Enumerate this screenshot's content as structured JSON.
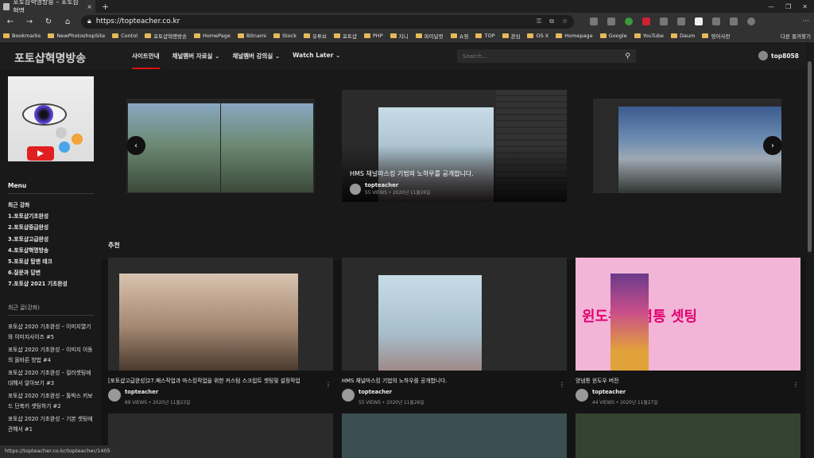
{
  "browser": {
    "tab_title": "포토샵혁명방송 – 포토샵혁명",
    "tab_close": "×",
    "new_tab": "+",
    "url": "https://topteacher.co.kr",
    "window_controls": [
      "—",
      "❐",
      "✕"
    ],
    "menu_more": "···"
  },
  "bookmarks": [
    "Bookmarks",
    "NewPhotoshopSite",
    "Contol",
    "포토샵혁명방송",
    "HomePage",
    "Bitnami",
    "Stock",
    "유투브",
    "포토샵",
    "PHP",
    "지니",
    "파이널컷",
    "쇼핑",
    "TOP",
    "관심",
    "OS X",
    "Homepage",
    "Google",
    "YouTube",
    "Daum",
    "영어사전"
  ],
  "bookmarks_more": "다른 즐겨찾기",
  "site": {
    "logo": "포토샵혁명방송",
    "menu": [
      "사이트안내",
      "채널멤버 자료실",
      "채널멤버 강의실",
      "Watch Later"
    ],
    "search_placeholder": "Search...",
    "user": "top8058"
  },
  "sidebar": {
    "menu_title": "Menu",
    "menu_items": [
      "최근 강좌",
      "1.포토샵기초완성",
      "2.포토샵중급완성",
      "3.포토샵고급완성",
      "4.포토샵혁명방송",
      "5.포토샵 탑맨 테크",
      "6.질문과 답변",
      "7.포토샵 2021 기초완성"
    ],
    "recent_title": "최근 글(강좌)",
    "recent_items": [
      "포토샵 2020 기초완성 – 이미지열기와 이미지사이즈 #5",
      "포토샵 2020 기초완성 – 이미지 이동의 올바른 방법 #4",
      "포토샵 2020 기초완성 – 컬러셋팅에 대해서 알아보기 #3",
      "포토샵 2020 기초완성 – 툴박스 키보드 단축키 셋팅하기 #2",
      "포토샵 2020 기초완성 – 기본 셋팅에 관해서 #1"
    ]
  },
  "status_url": "https://topteacher.co.kr/topteacher/1405",
  "slider": {
    "caption": "HMS 채널마스킹 기법의 노하우를 공개합니다.",
    "author": "topteacher",
    "meta": "55 VIEWS  •  2020년 11월26일",
    "prev": "‹",
    "next": "›"
  },
  "recommend_title": "추천",
  "cards": [
    {
      "title": "[포토샵고급완성]27.패스작업과 마스킹작업을 위한 커스텀 스크립트 셋팅및 설정작업",
      "author": "topteacher",
      "meta": "88 VIEWS  •  2020년 11월23일"
    },
    {
      "title": "HMS 채널마스킹 기법의 노하우를 공개합니다.",
      "author": "topteacher",
      "meta": "55 VIEWS  •  2020년 11월26일"
    },
    {
      "title": "양념통 윈도우 버전",
      "author": "topteacher",
      "meta": "44 VIEWS  •  2020년 11월27일",
      "overlay_text": "윈도우 양념통 셋팅"
    }
  ],
  "kebab": "⋮"
}
